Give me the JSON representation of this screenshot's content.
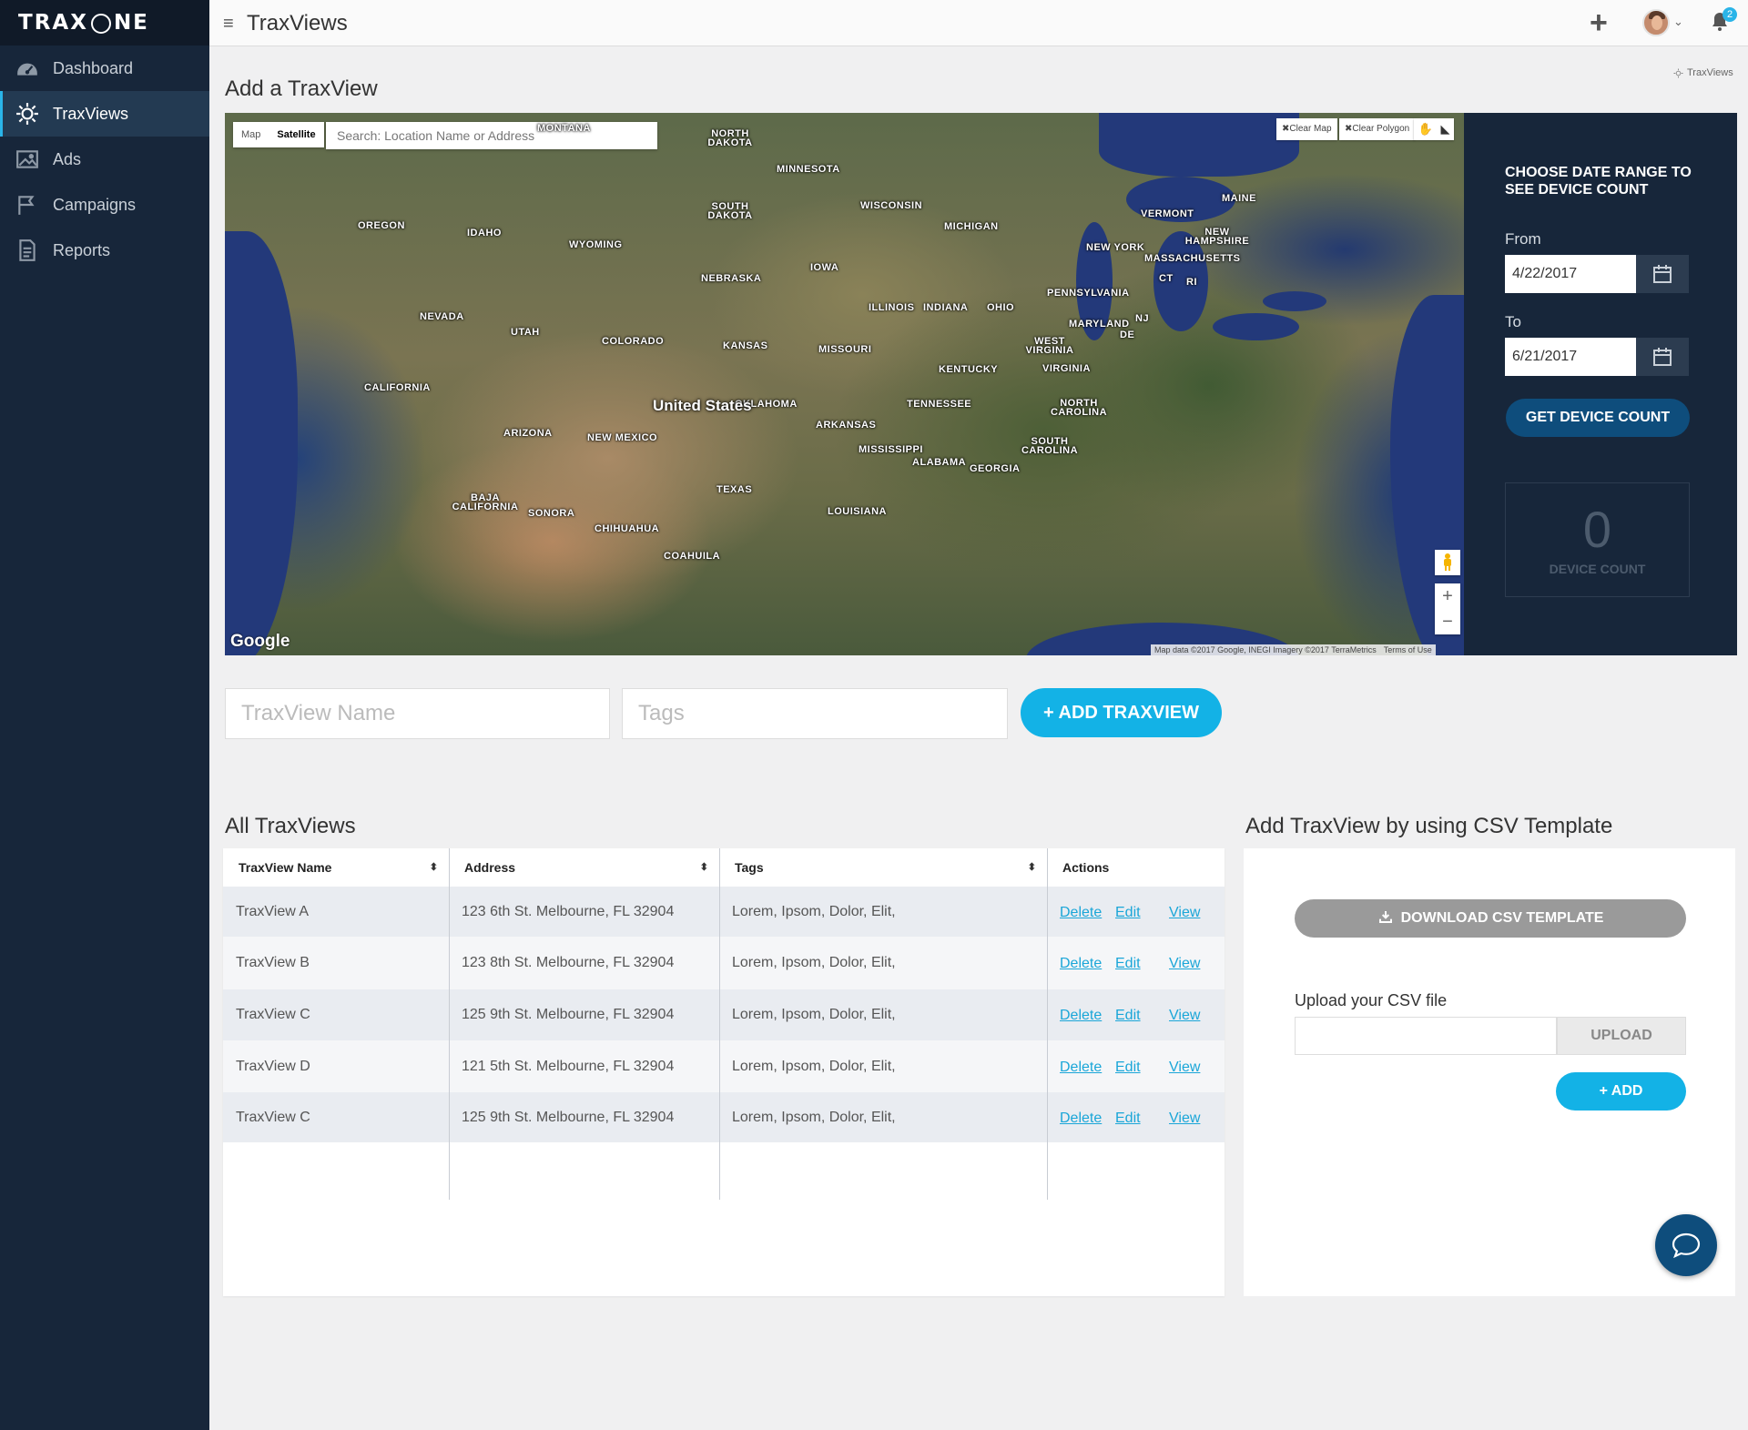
{
  "app": {
    "logo_text_left": "TRAX",
    "logo_text_right": "NE"
  },
  "sidebar": {
    "items": [
      {
        "label": "Dashboard",
        "icon": "dashboard-gauge-icon",
        "active": false
      },
      {
        "label": "TraxViews",
        "icon": "traxview-sun-icon",
        "active": true
      },
      {
        "label": "Ads",
        "icon": "image-icon",
        "active": false
      },
      {
        "label": "Campaigns",
        "icon": "flag-icon",
        "active": false
      },
      {
        "label": "Reports",
        "icon": "document-icon",
        "active": false
      }
    ]
  },
  "topbar": {
    "title": "TraxViews",
    "notification_count": "2"
  },
  "page": {
    "heading": "Add a TraxView",
    "breadcrumb": "TraxViews"
  },
  "map": {
    "type_map": "Map",
    "type_satellite": "Satellite",
    "search_placeholder": "Search: Location Name or Address",
    "clear_map": "✖Clear Map",
    "clear_polygon": "✖Clear Polygon",
    "google": "Google",
    "attribution": "Map data ©2017 Google, INEGI Imagery ©2017 TerraMetrics",
    "terms": "Terms of Use",
    "country": "United States",
    "labels": [
      "MONTANA",
      "NORTH DAKOTA",
      "MINNESOTA",
      "WISCONSIN",
      "MICHIGAN",
      "MAINE",
      "VERMONT",
      "NEW HAMPSHIRE",
      "MASSACHUSETTS",
      "NEW YORK",
      "CT",
      "RI",
      "OREGON",
      "IDAHO",
      "WYOMING",
      "SOUTH DAKOTA",
      "IOWA",
      "NEBRASKA",
      "PENNSYLVANIA",
      "NJ",
      "ILLINOIS",
      "INDIANA",
      "OHIO",
      "MARYLAND",
      "DE",
      "NEVADA",
      "UTAH",
      "COLORADO",
      "KANSAS",
      "MISSOURI",
      "WEST VIRGINIA",
      "VIRGINIA",
      "KENTUCKY",
      "CALIFORNIA",
      "OKLAHOMA",
      "TENNESSEE",
      "NORTH CAROLINA",
      "ARKANSAS",
      "ARIZONA",
      "NEW MEXICO",
      "SOUTH CAROLINA",
      "MISSISSIPPI",
      "ALABAMA",
      "GEORGIA",
      "TEXAS",
      "LOUISIANA",
      "BAJA CALIFORNIA",
      "SONORA",
      "CHIHUAHUA",
      "COAHUILA"
    ]
  },
  "date_panel": {
    "title": "CHOOSE DATE RANGE TO SEE DEVICE COUNT",
    "from_label": "From",
    "from_value": "4/22/2017",
    "to_label": "To",
    "to_value": "6/21/2017",
    "button": "GET DEVICE COUNT",
    "count": "0",
    "count_label": "DEVICE COUNT"
  },
  "form": {
    "name_placeholder": "TraxView Name",
    "tags_placeholder": "Tags",
    "add_button": "+ ADD TRAXVIEW"
  },
  "table": {
    "title": "All TraxViews",
    "columns": [
      "TraxView Name",
      "Address",
      "Tags",
      "Actions"
    ],
    "sort_glyph": "⬍",
    "actions": {
      "delete": "Delete",
      "edit": "Edit",
      "view": "View"
    },
    "rows": [
      {
        "name": "TraxView A",
        "address": "123 6th St. Melbourne, FL 32904",
        "tags": "Lorem, Ipsom, Dolor, Elit,"
      },
      {
        "name": "TraxView B",
        "address": "123 8th St. Melbourne, FL 32904",
        "tags": "Lorem, Ipsom, Dolor, Elit,"
      },
      {
        "name": "TraxView C",
        "address": "125 9th St. Melbourne, FL 32904",
        "tags": "Lorem, Ipsom, Dolor, Elit,"
      },
      {
        "name": "TraxView D",
        "address": "121 5th St. Melbourne, FL 32904",
        "tags": "Lorem, Ipsom, Dolor, Elit,"
      },
      {
        "name": "TraxView C",
        "address": "125 9th St. Melbourne, FL 32904",
        "tags": "Lorem, Ipsom, Dolor, Elit,"
      }
    ]
  },
  "csv": {
    "title": "Add TraxView by using CSV Template",
    "download_button": "DOWNLOAD CSV TEMPLATE",
    "upload_label": "Upload your CSV file",
    "upload_button": "UPLOAD",
    "add_button": "+ ADD"
  },
  "colors": {
    "sidebar": "#17263a",
    "accent": "#13b2e6",
    "primary_dark": "#0e4d7c"
  }
}
